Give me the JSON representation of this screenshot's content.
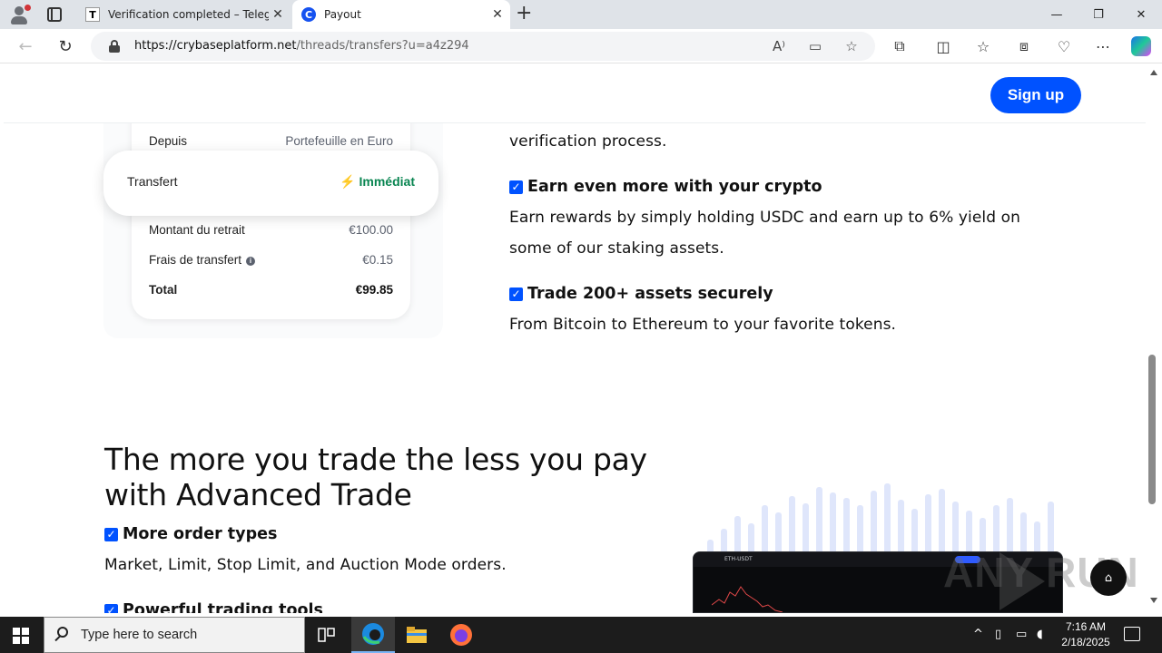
{
  "browser": {
    "tabs": [
      {
        "label": "Verification completed – Telegraph",
        "favicon": "T"
      },
      {
        "label": "Payout",
        "favicon": "C"
      }
    ],
    "url_host": "https://crybaseplatform.net",
    "url_path": "/threads/transfers?u=a4z294",
    "window_controls": {
      "minimize": "—",
      "maximize": "❐",
      "close": "✕"
    },
    "new_tab": "+"
  },
  "header": {
    "signup_label": "Sign up"
  },
  "receipt": {
    "from_label": "Depuis",
    "from_value": "Portefeuille en Euro",
    "transfer_label": "Transfert",
    "transfer_value": "⚡ Immédiat",
    "amount_label": "Montant du retrait",
    "amount_value": "€100.00",
    "fee_label": "Frais de transfert",
    "fee_value": "€0.15",
    "total_label": "Total",
    "total_value": "€99.85"
  },
  "features": {
    "intro_tail": "verification process.",
    "earn_title": "Earn even more with your crypto",
    "earn_line1": "Earn rewards by simply holding USDC and earn up to 6% yield on",
    "earn_line2": "some of our staking assets.",
    "trade_title": "Trade 200+ assets securely",
    "trade_desc": "From Bitcoin to Ethereum to your favorite tokens."
  },
  "advanced": {
    "heading_line1": "The more you trade the less you pay",
    "heading_line2": "with Advanced Trade",
    "order_title": "More order types",
    "order_desc": "Market, Limit, Stop Limit, and Auction Mode orders.",
    "tools_title": "Powerful trading tools",
    "terminal_pair": "ETH-USDT"
  },
  "watermark": "ANY RUN",
  "taskbar": {
    "search_placeholder": "Type here to search",
    "time": "7:16 AM",
    "date": "2/18/2025"
  },
  "colors": {
    "brand_blue": "#0052ff",
    "success_green": "#098551"
  }
}
